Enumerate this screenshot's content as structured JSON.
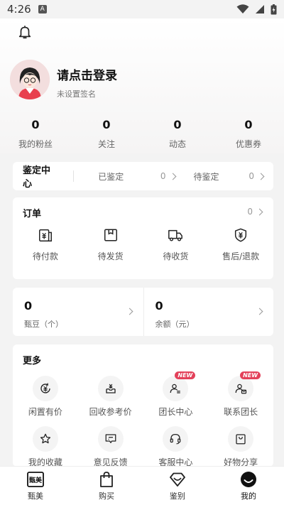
{
  "status_bar": {
    "time": "4:26",
    "notification": "A"
  },
  "profile": {
    "login_prompt": "请点击登录",
    "signature": "未设置签名"
  },
  "stats": [
    {
      "value": "0",
      "label": "我的粉丝"
    },
    {
      "value": "0",
      "label": "关注"
    },
    {
      "value": "0",
      "label": "动态"
    },
    {
      "value": "0",
      "label": "优惠券"
    }
  ],
  "appraisal": {
    "title": "鉴定中心",
    "done_label": "已鉴定",
    "done_count": "0",
    "pending_label": "待鉴定",
    "pending_count": "0"
  },
  "orders": {
    "title": "订单",
    "count": "0",
    "items": [
      {
        "label": "待付款",
        "icon": "payment-icon"
      },
      {
        "label": "待发货",
        "icon": "box-icon"
      },
      {
        "label": "待收货",
        "icon": "truck-icon"
      },
      {
        "label": "售后/退款",
        "icon": "shield-yen-icon"
      }
    ]
  },
  "wallet": {
    "beans_value": "0",
    "beans_label": "甄豆（个）",
    "balance_value": "0",
    "balance_label": "余额（元）"
  },
  "more": {
    "title": "更多",
    "badge": "NEW",
    "items": [
      {
        "label": "闲置有价",
        "icon": "yen-cycle-icon"
      },
      {
        "label": "回收参考价",
        "icon": "recycle-tray-icon"
      },
      {
        "label": "团长中心",
        "icon": "leader-icon"
      },
      {
        "label": "联系团长",
        "icon": "contact-leader-icon"
      },
      {
        "label": "我的收藏",
        "icon": "star-icon"
      },
      {
        "label": "意见反馈",
        "icon": "feedback-icon"
      },
      {
        "label": "客服中心",
        "icon": "headset-icon"
      },
      {
        "label": "好物分享",
        "icon": "share-bag-icon"
      }
    ]
  },
  "tabbar": [
    {
      "label": "甄美",
      "logo": "甄美"
    },
    {
      "label": "购买"
    },
    {
      "label": "鉴别"
    },
    {
      "label": "我的"
    }
  ],
  "colors": {
    "accent": "#e3415a",
    "background": "#f3f3f3"
  }
}
